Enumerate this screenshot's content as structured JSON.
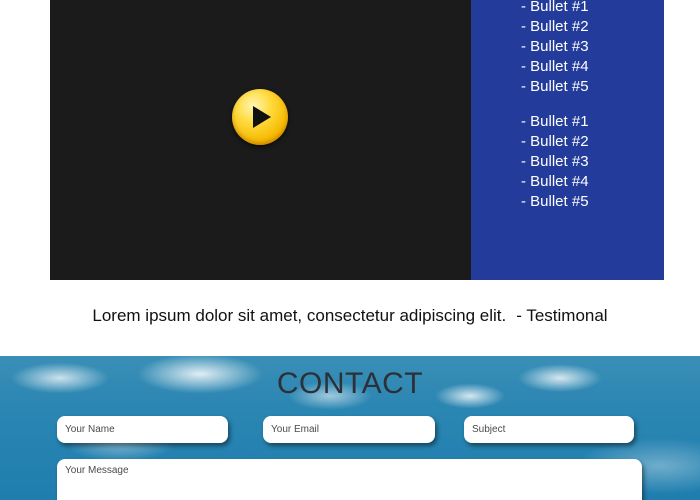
{
  "video": {
    "play_icon": "play-icon",
    "play_button_color": "#f5b800",
    "panel_color": "#1b1b1b"
  },
  "bullets": {
    "panel_color": "#233c9b",
    "group1": [
      "- Bullet #1",
      "- Bullet #2",
      "- Bullet #3",
      "- Bullet #4",
      "- Bullet #5"
    ],
    "group2": [
      "- Bullet #1",
      "- Bullet #2",
      "- Bullet #3",
      "- Bullet #4",
      "- Bullet #5"
    ]
  },
  "testimonial": {
    "quote": "Lorem ipsum dolor sit amet, consectetur adipiscing elit.",
    "author": "- Testimonal"
  },
  "contact": {
    "title": "CONTACT",
    "name_placeholder": "Your Name",
    "email_placeholder": "Your Email",
    "subject_placeholder": "Subject",
    "message_placeholder": "Your Message"
  }
}
